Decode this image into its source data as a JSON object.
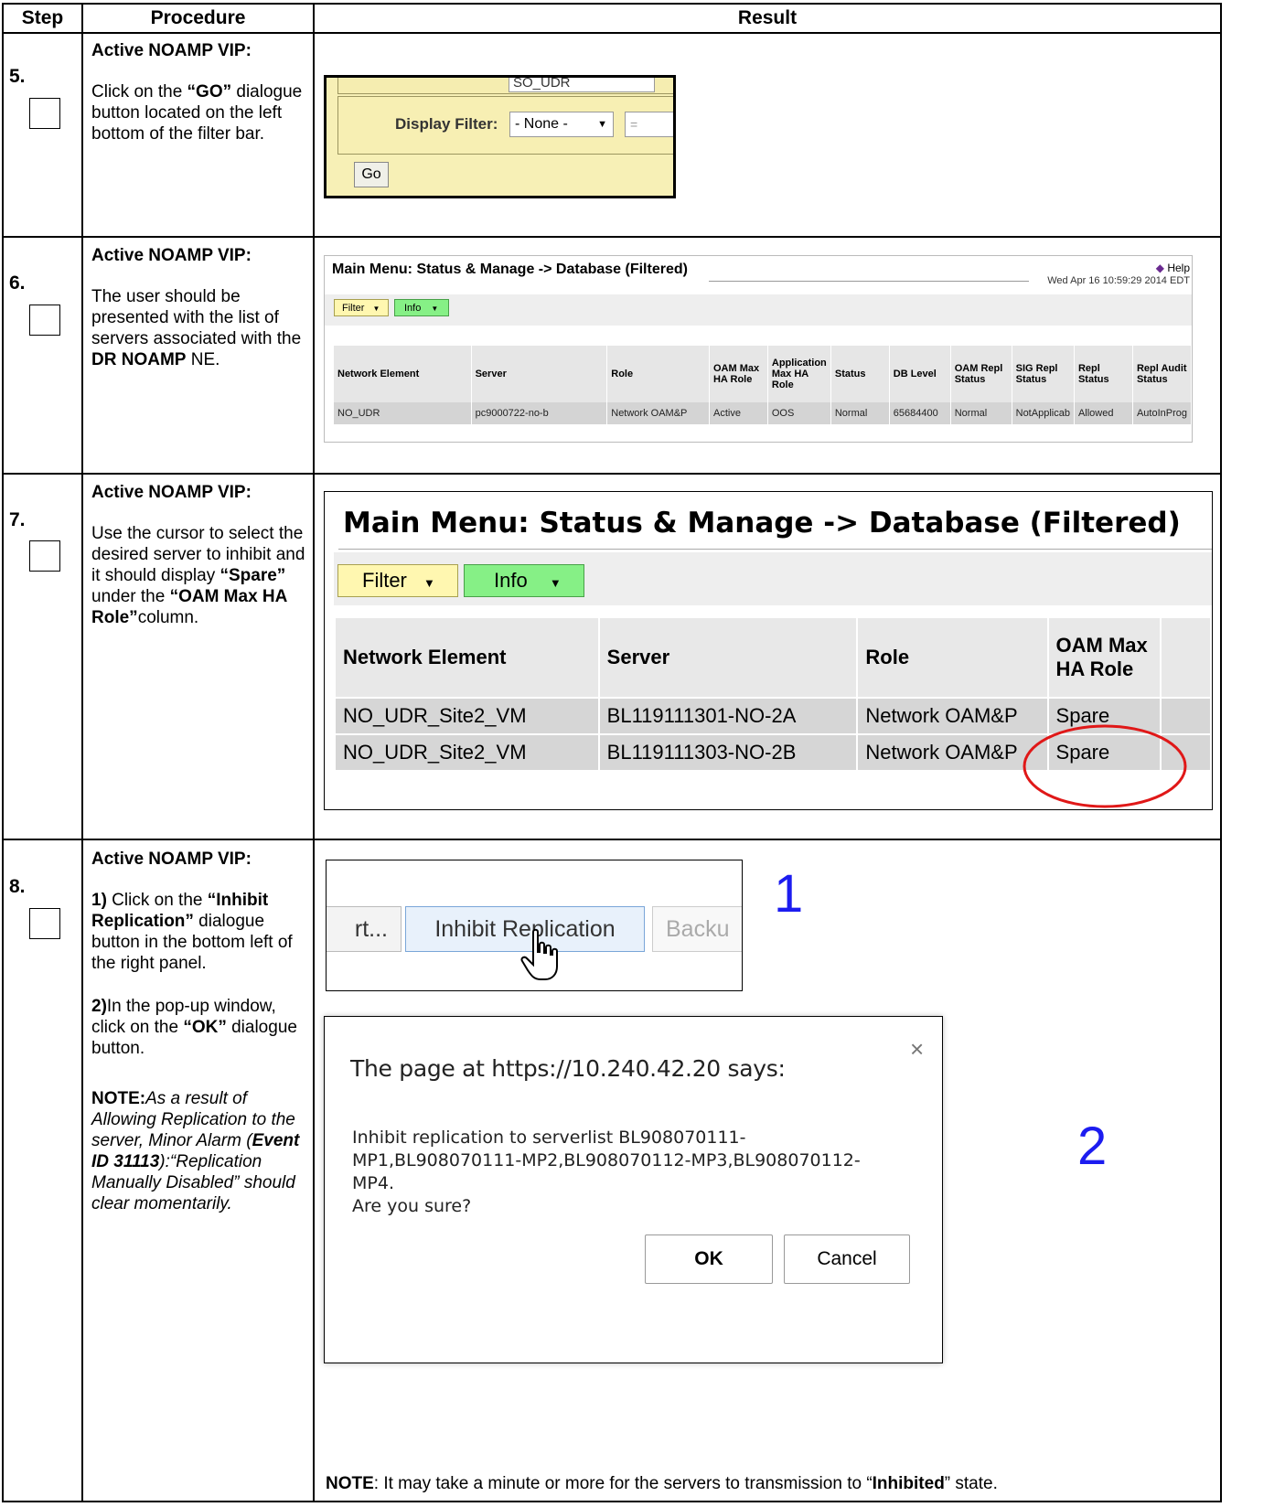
{
  "headers": {
    "step": "Step",
    "procedure": "Procedure",
    "result": "Result"
  },
  "steps": [
    {
      "num": "5.",
      "title": "Active NOAMP VIP:",
      "text_a": "Click on the ",
      "text_b": "“GO”",
      "text_c": " dialogue button located on the left bottom of the filter bar."
    },
    {
      "num": "6.",
      "title": "Active NOAMP VIP:",
      "text_a": "The user should be presented with the list of servers associated with the ",
      "text_b": "DR NOAMP",
      "text_c": " NE."
    },
    {
      "num": "7.",
      "title": "Active NOAMP VIP:",
      "text_a": "Use the cursor to select the desired server to inhibit and it should display ",
      "text_b": "“Spare”",
      "text_c": " under the ",
      "text_d": "“OAM Max HA Role”",
      "text_e": "column."
    },
    {
      "num": "8.",
      "title": "Active NOAMP VIP:",
      "p1_bold": "1)",
      "p1_text": " Click on the ",
      "p1_btn": "“Inhibit Replication”",
      "p1_tail": " dialogue button in the bottom left of the right panel.",
      "p2_bold": "2)",
      "p2_text": "In the pop-up window, click on the ",
      "p2_btn": "“OK”",
      "p2_tail": " dialogue button.",
      "note_label": "NOTE:",
      "note_1": "As a result of Allowing Replication to the server, Minor Alarm (",
      "note_event": "Event ID 31113",
      "note_2": "):“Replication Manually Disabled” should clear momentarily."
    }
  ],
  "s5_shot": {
    "top_text": "SO_UDR",
    "filter_label": "Display Filter:",
    "select_value": "- None -",
    "op_value": "=",
    "go_label": "Go"
  },
  "s6_shot": {
    "title": "Main Menu: Status & Manage -> Database (Filtered)",
    "help": "Help",
    "timestamp": "Wed Apr 16 10:59:29 2014 EDT",
    "filter_btn": "Filter",
    "info_btn": "Info",
    "columns": [
      "Network Element",
      "Server",
      "Role",
      "OAM Max HA Role",
      "Application Max HA Role",
      "Status",
      "DB Level",
      "OAM Repl Status",
      "SIG Repl Status",
      "Repl Status",
      "Repl Audit Status"
    ],
    "row": [
      "NO_UDR",
      "pc9000722-no-b",
      "Network OAM&P",
      "Active",
      "OOS",
      "Normal",
      "65684400",
      "Normal",
      "NotApplicab",
      "Allowed",
      "AutoInProg"
    ]
  },
  "s7_shot": {
    "title": "Main Menu: Status & Manage -> Database (Filtered)",
    "filter_btn": "Filter",
    "info_btn": "Info",
    "columns": [
      "Network Element",
      "Server",
      "Role",
      "OAM Max HA Role"
    ],
    "rows": [
      [
        "NO_UDR_Site2_VM",
        "BL119111301-NO-2A",
        "Network OAM&P",
        "Spare"
      ],
      [
        "NO_UDR_Site2_VM",
        "BL119111303-NO-2B",
        "Network OAM&P",
        "Spare"
      ]
    ]
  },
  "s8_shot1": {
    "prev_btn": "rt...",
    "inhibit_btn": "Inhibit Replication",
    "next_btn": "Backu",
    "marker": "1"
  },
  "s8_shot2": {
    "title": "The page at https://10.240.42.20 says:",
    "close": "×",
    "message_1": "Inhibit replication to serverlist BL908070111-",
    "message_2": "MP1,BL908070111-MP2,BL908070112-MP3,BL908070112-",
    "message_3": "MP4.",
    "message_4": "Are you sure?",
    "ok": "OK",
    "cancel": "Cancel",
    "marker": "2"
  },
  "s8_note": {
    "label": "NOTE",
    "text_a": ": It may take a minute or more for the servers to transmission to “",
    "bold": "Inhibited",
    "text_b": "” state."
  }
}
